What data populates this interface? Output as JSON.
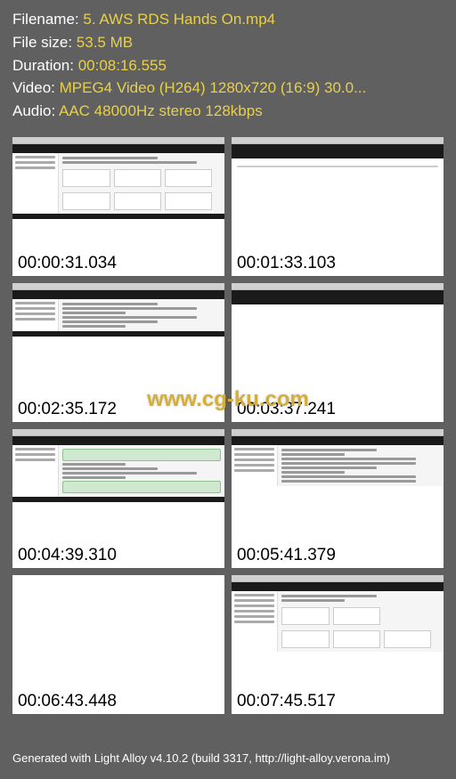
{
  "info": {
    "filename_label": "Filename: ",
    "filename_value": "5. AWS RDS Hands On.mp4",
    "filesize_label": "File size: ",
    "filesize_value": "53.5 MB",
    "duration_label": "Duration: ",
    "duration_value": "00:08:16.555",
    "video_label": "Video: ",
    "video_value": "MPEG4 Video (H264) 1280x720 (16:9) 30.0...",
    "audio_label": "Audio: ",
    "audio_value": "AAC 48000Hz stereo 128kbps"
  },
  "thumbnails": [
    {
      "time": "00:00:31.034",
      "variant": "engine"
    },
    {
      "time": "00:01:33.103",
      "variant": "settings"
    },
    {
      "time": "00:02:35.172",
      "variant": "network"
    },
    {
      "time": "00:03:37.241",
      "variant": "encryption"
    },
    {
      "time": "00:04:39.310",
      "variant": "maintenance"
    },
    {
      "time": "00:05:41.379",
      "variant": "version"
    },
    {
      "time": "00:06:43.448",
      "variant": "dialog"
    },
    {
      "time": "00:07:45.517",
      "variant": "summary"
    }
  ],
  "watermark": "www.cg-ku.com",
  "footer": "Generated with Light Alloy v4.10.2 (build 3317, http://light-alloy.verona.im)"
}
